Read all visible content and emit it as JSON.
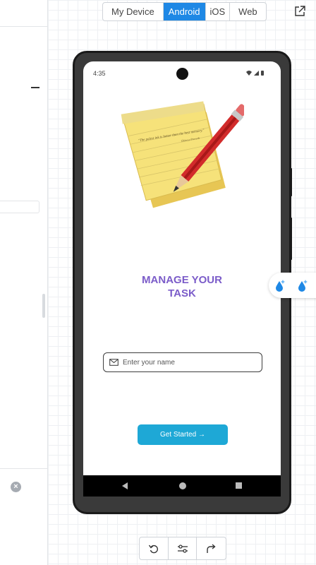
{
  "tabs": [
    "My Device",
    "Android",
    "iOS",
    "Web"
  ],
  "active_tab": "Android",
  "status_bar": {
    "time": "4:35"
  },
  "app": {
    "note_quote": "\"The palest ink is better than the best memory.\"",
    "note_author": "Chinese Proverb",
    "title_line1": "MANAGE YOUR",
    "title_line2": "TASK",
    "name_placeholder": "Enter your name",
    "cta_label": "Get Started →"
  },
  "colors": {
    "accent_tab": "#1e88e5",
    "title": "#7b5cc9",
    "cta": "#1ea8d6"
  },
  "icons": [
    "external-link-icon",
    "mail-icon",
    "undo-icon",
    "settings-sliders-icon",
    "redo-icon",
    "water-drop-icon",
    "close-icon"
  ]
}
